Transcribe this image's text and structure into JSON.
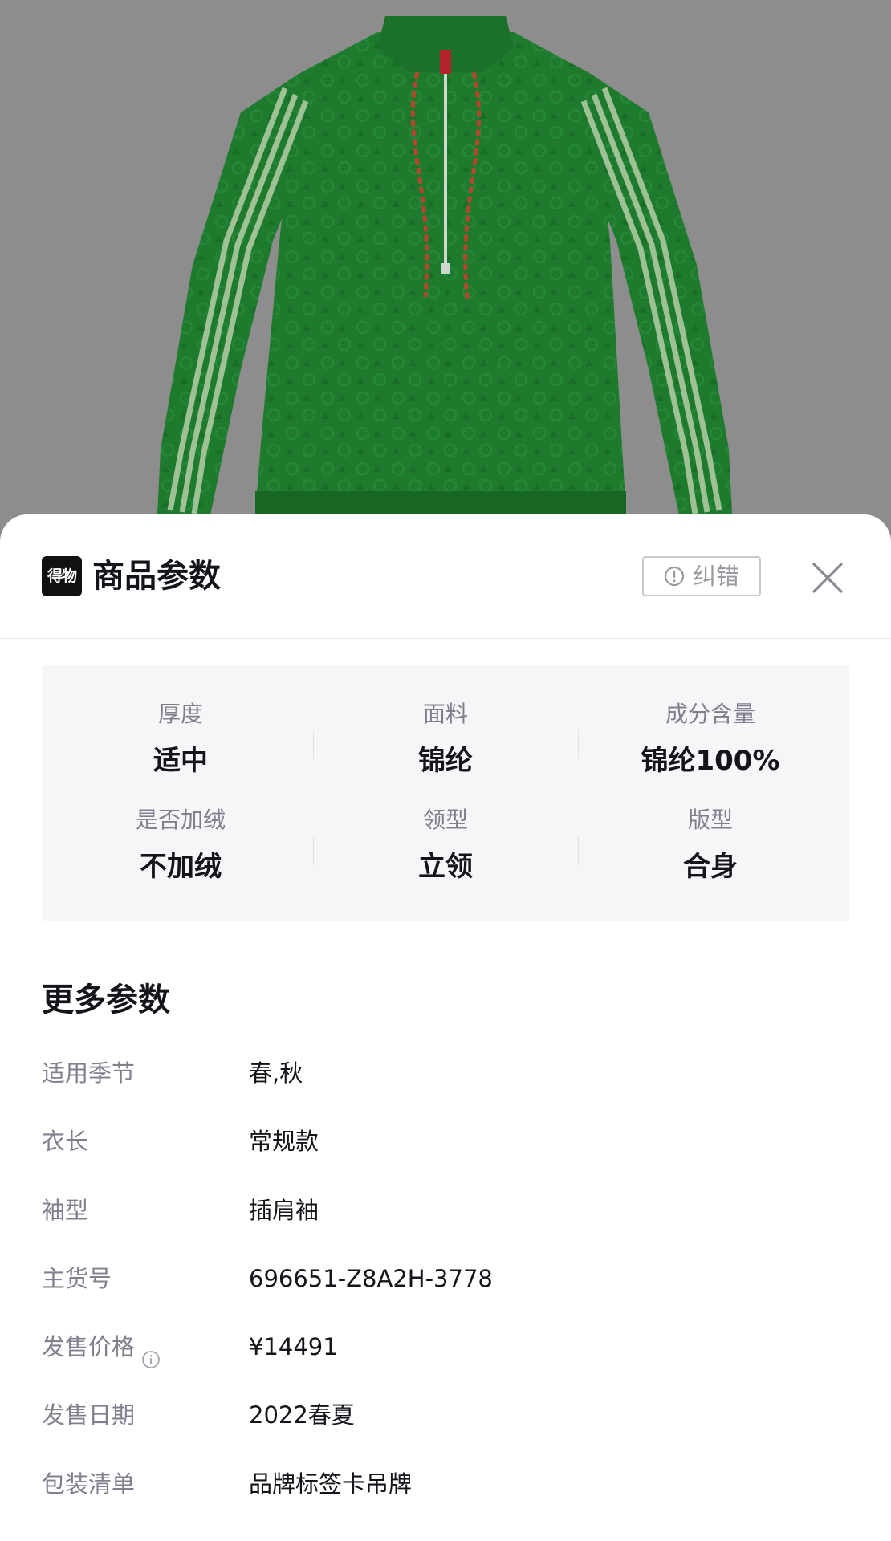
{
  "sheet": {
    "logo_text": "得物",
    "title": "商品参数",
    "report_label": "纠错",
    "report_icon": "exclamation-circle-icon",
    "close_icon": "close-icon"
  },
  "key_specs": [
    {
      "label": "厚度",
      "value": "适中"
    },
    {
      "label": "面料",
      "value": "锦纶"
    },
    {
      "label": "成分含量",
      "value": "锦纶100%"
    },
    {
      "label": "是否加绒",
      "value": "不加绒"
    },
    {
      "label": "领型",
      "value": "立领"
    },
    {
      "label": "版型",
      "value": "合身"
    }
  ],
  "more_params": {
    "title": "更多参数",
    "rows": [
      {
        "key": "适用季节",
        "value": "春,秋"
      },
      {
        "key": "衣长",
        "value": "常规款"
      },
      {
        "key": "袖型",
        "value": "插肩袖"
      },
      {
        "key": "主货号",
        "value": "696651-Z8A2H-3778"
      },
      {
        "key": "发售价格",
        "value": "¥14491",
        "info_icon": true
      },
      {
        "key": "发售日期",
        "value": "2022春夏"
      },
      {
        "key": "包装清单",
        "value": "品牌标签卡吊牌"
      }
    ]
  },
  "colors": {
    "photo_background": "#8d8d8d",
    "jacket_green": "#1f7a2e",
    "stripe": "#a8c8a0",
    "label_gray": "#7f7f8e",
    "text_dark": "#14151a"
  }
}
